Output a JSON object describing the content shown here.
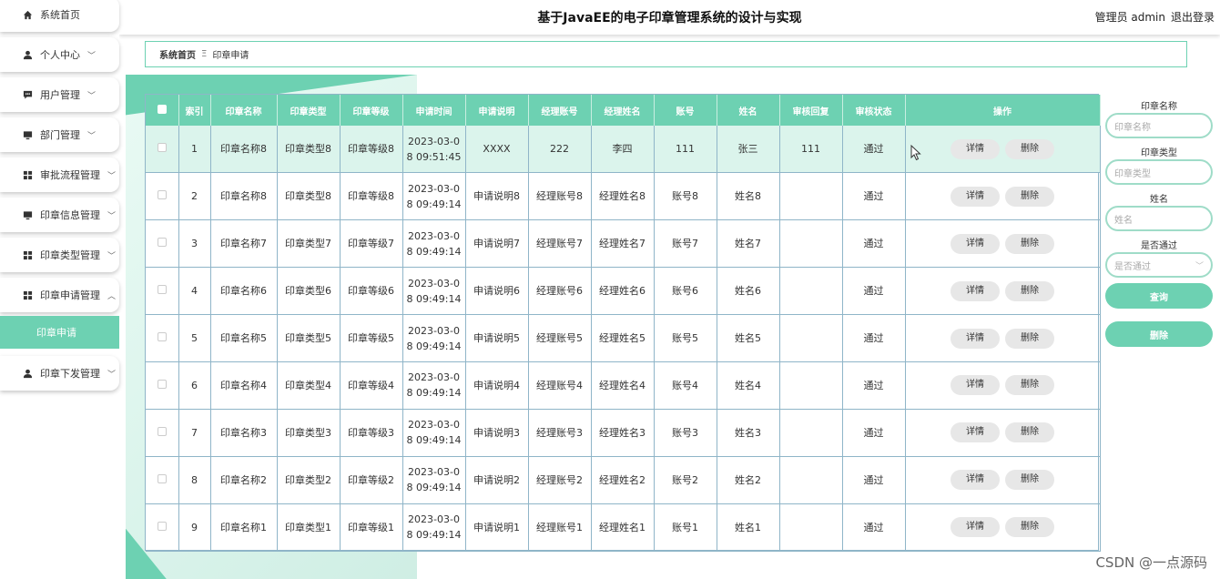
{
  "header": {
    "title": "基于JavaEE的电子印章管理系统的设计与实现",
    "user": "管理员 admin",
    "logout": "退出登录"
  },
  "sidebar": {
    "items": [
      {
        "label": "系统首页",
        "icon": "home-icon",
        "chevron": ""
      },
      {
        "label": "个人中心",
        "icon": "user-icon",
        "chevron": "﹀"
      },
      {
        "label": "用户管理",
        "icon": "chat-icon",
        "chevron": "﹀"
      },
      {
        "label": "部门管理",
        "icon": "monitor-icon",
        "chevron": "﹀"
      },
      {
        "label": "审批流程管理",
        "icon": "grid-icon",
        "chevron": "﹀"
      },
      {
        "label": "印章信息管理",
        "icon": "monitor-icon",
        "chevron": "﹀"
      },
      {
        "label": "印章类型管理",
        "icon": "grid-icon",
        "chevron": "﹀"
      },
      {
        "label": "印章申请管理",
        "icon": "grid-icon",
        "chevron": "︿"
      },
      {
        "label": "印章下发管理",
        "icon": "user-icon",
        "chevron": "﹀"
      }
    ],
    "active_sub": "印章申请"
  },
  "breadcrumb": {
    "home": "系统首页",
    "sep": "Ξ",
    "current": "印章申请"
  },
  "table": {
    "headers": [
      "",
      "索引",
      "印章名称",
      "印章类型",
      "印章等级",
      "申请时间",
      "申请说明",
      "经理账号",
      "经理姓名",
      "账号",
      "姓名",
      "审核回复",
      "审核状态",
      "操作"
    ],
    "detail_label": "详情",
    "delete_label": "删除",
    "rows": [
      {
        "idx": "1",
        "name": "印章名称8",
        "type": "印章类型8",
        "level": "印章等级8",
        "time1": "2023-03-0",
        "time2": "8 09:51:45",
        "desc": "XXXX",
        "mgr_acc": "222",
        "mgr_name": "李四",
        "acc": "111",
        "uname": "张三",
        "reply": "111",
        "status": "通过"
      },
      {
        "idx": "2",
        "name": "印章名称8",
        "type": "印章类型8",
        "level": "印章等级8",
        "time1": "2023-03-0",
        "time2": "8 09:49:14",
        "desc": "申请说明8",
        "mgr_acc": "经理账号8",
        "mgr_name": "经理姓名8",
        "acc": "账号8",
        "uname": "姓名8",
        "reply": "",
        "status": "通过"
      },
      {
        "idx": "3",
        "name": "印章名称7",
        "type": "印章类型7",
        "level": "印章等级7",
        "time1": "2023-03-0",
        "time2": "8 09:49:14",
        "desc": "申请说明7",
        "mgr_acc": "经理账号7",
        "mgr_name": "经理姓名7",
        "acc": "账号7",
        "uname": "姓名7",
        "reply": "",
        "status": "通过"
      },
      {
        "idx": "4",
        "name": "印章名称6",
        "type": "印章类型6",
        "level": "印章等级6",
        "time1": "2023-03-0",
        "time2": "8 09:49:14",
        "desc": "申请说明6",
        "mgr_acc": "经理账号6",
        "mgr_name": "经理姓名6",
        "acc": "账号6",
        "uname": "姓名6",
        "reply": "",
        "status": "通过"
      },
      {
        "idx": "5",
        "name": "印章名称5",
        "type": "印章类型5",
        "level": "印章等级5",
        "time1": "2023-03-0",
        "time2": "8 09:49:14",
        "desc": "申请说明5",
        "mgr_acc": "经理账号5",
        "mgr_name": "经理姓名5",
        "acc": "账号5",
        "uname": "姓名5",
        "reply": "",
        "status": "通过"
      },
      {
        "idx": "6",
        "name": "印章名称4",
        "type": "印章类型4",
        "level": "印章等级4",
        "time1": "2023-03-0",
        "time2": "8 09:49:14",
        "desc": "申请说明4",
        "mgr_acc": "经理账号4",
        "mgr_name": "经理姓名4",
        "acc": "账号4",
        "uname": "姓名4",
        "reply": "",
        "status": "通过"
      },
      {
        "idx": "7",
        "name": "印章名称3",
        "type": "印章类型3",
        "level": "印章等级3",
        "time1": "2023-03-0",
        "time2": "8 09:49:14",
        "desc": "申请说明3",
        "mgr_acc": "经理账号3",
        "mgr_name": "经理姓名3",
        "acc": "账号3",
        "uname": "姓名3",
        "reply": "",
        "status": "通过"
      },
      {
        "idx": "8",
        "name": "印章名称2",
        "type": "印章类型2",
        "level": "印章等级2",
        "time1": "2023-03-0",
        "time2": "8 09:49:14",
        "desc": "申请说明2",
        "mgr_acc": "经理账号2",
        "mgr_name": "经理姓名2",
        "acc": "账号2",
        "uname": "姓名2",
        "reply": "",
        "status": "通过"
      },
      {
        "idx": "9",
        "name": "印章名称1",
        "type": "印章类型1",
        "level": "印章等级1",
        "time1": "2023-03-0",
        "time2": "8 09:49:14",
        "desc": "申请说明1",
        "mgr_acc": "经理账号1",
        "mgr_name": "经理姓名1",
        "acc": "账号1",
        "uname": "姓名1",
        "reply": "",
        "status": "通过"
      }
    ]
  },
  "search": {
    "name_label": "印章名称",
    "name_placeholder": "印章名称",
    "type_label": "印章类型",
    "type_placeholder": "印章类型",
    "uname_label": "姓名",
    "uname_placeholder": "姓名",
    "pass_label": "是否通过",
    "pass_placeholder": "是否通过",
    "query_label": "查询",
    "delete_label": "删除"
  },
  "watermark": "CSDN @一点源码",
  "colors": {
    "accent": "#6dd1b2",
    "highlight_row": "#dbf4ec"
  }
}
